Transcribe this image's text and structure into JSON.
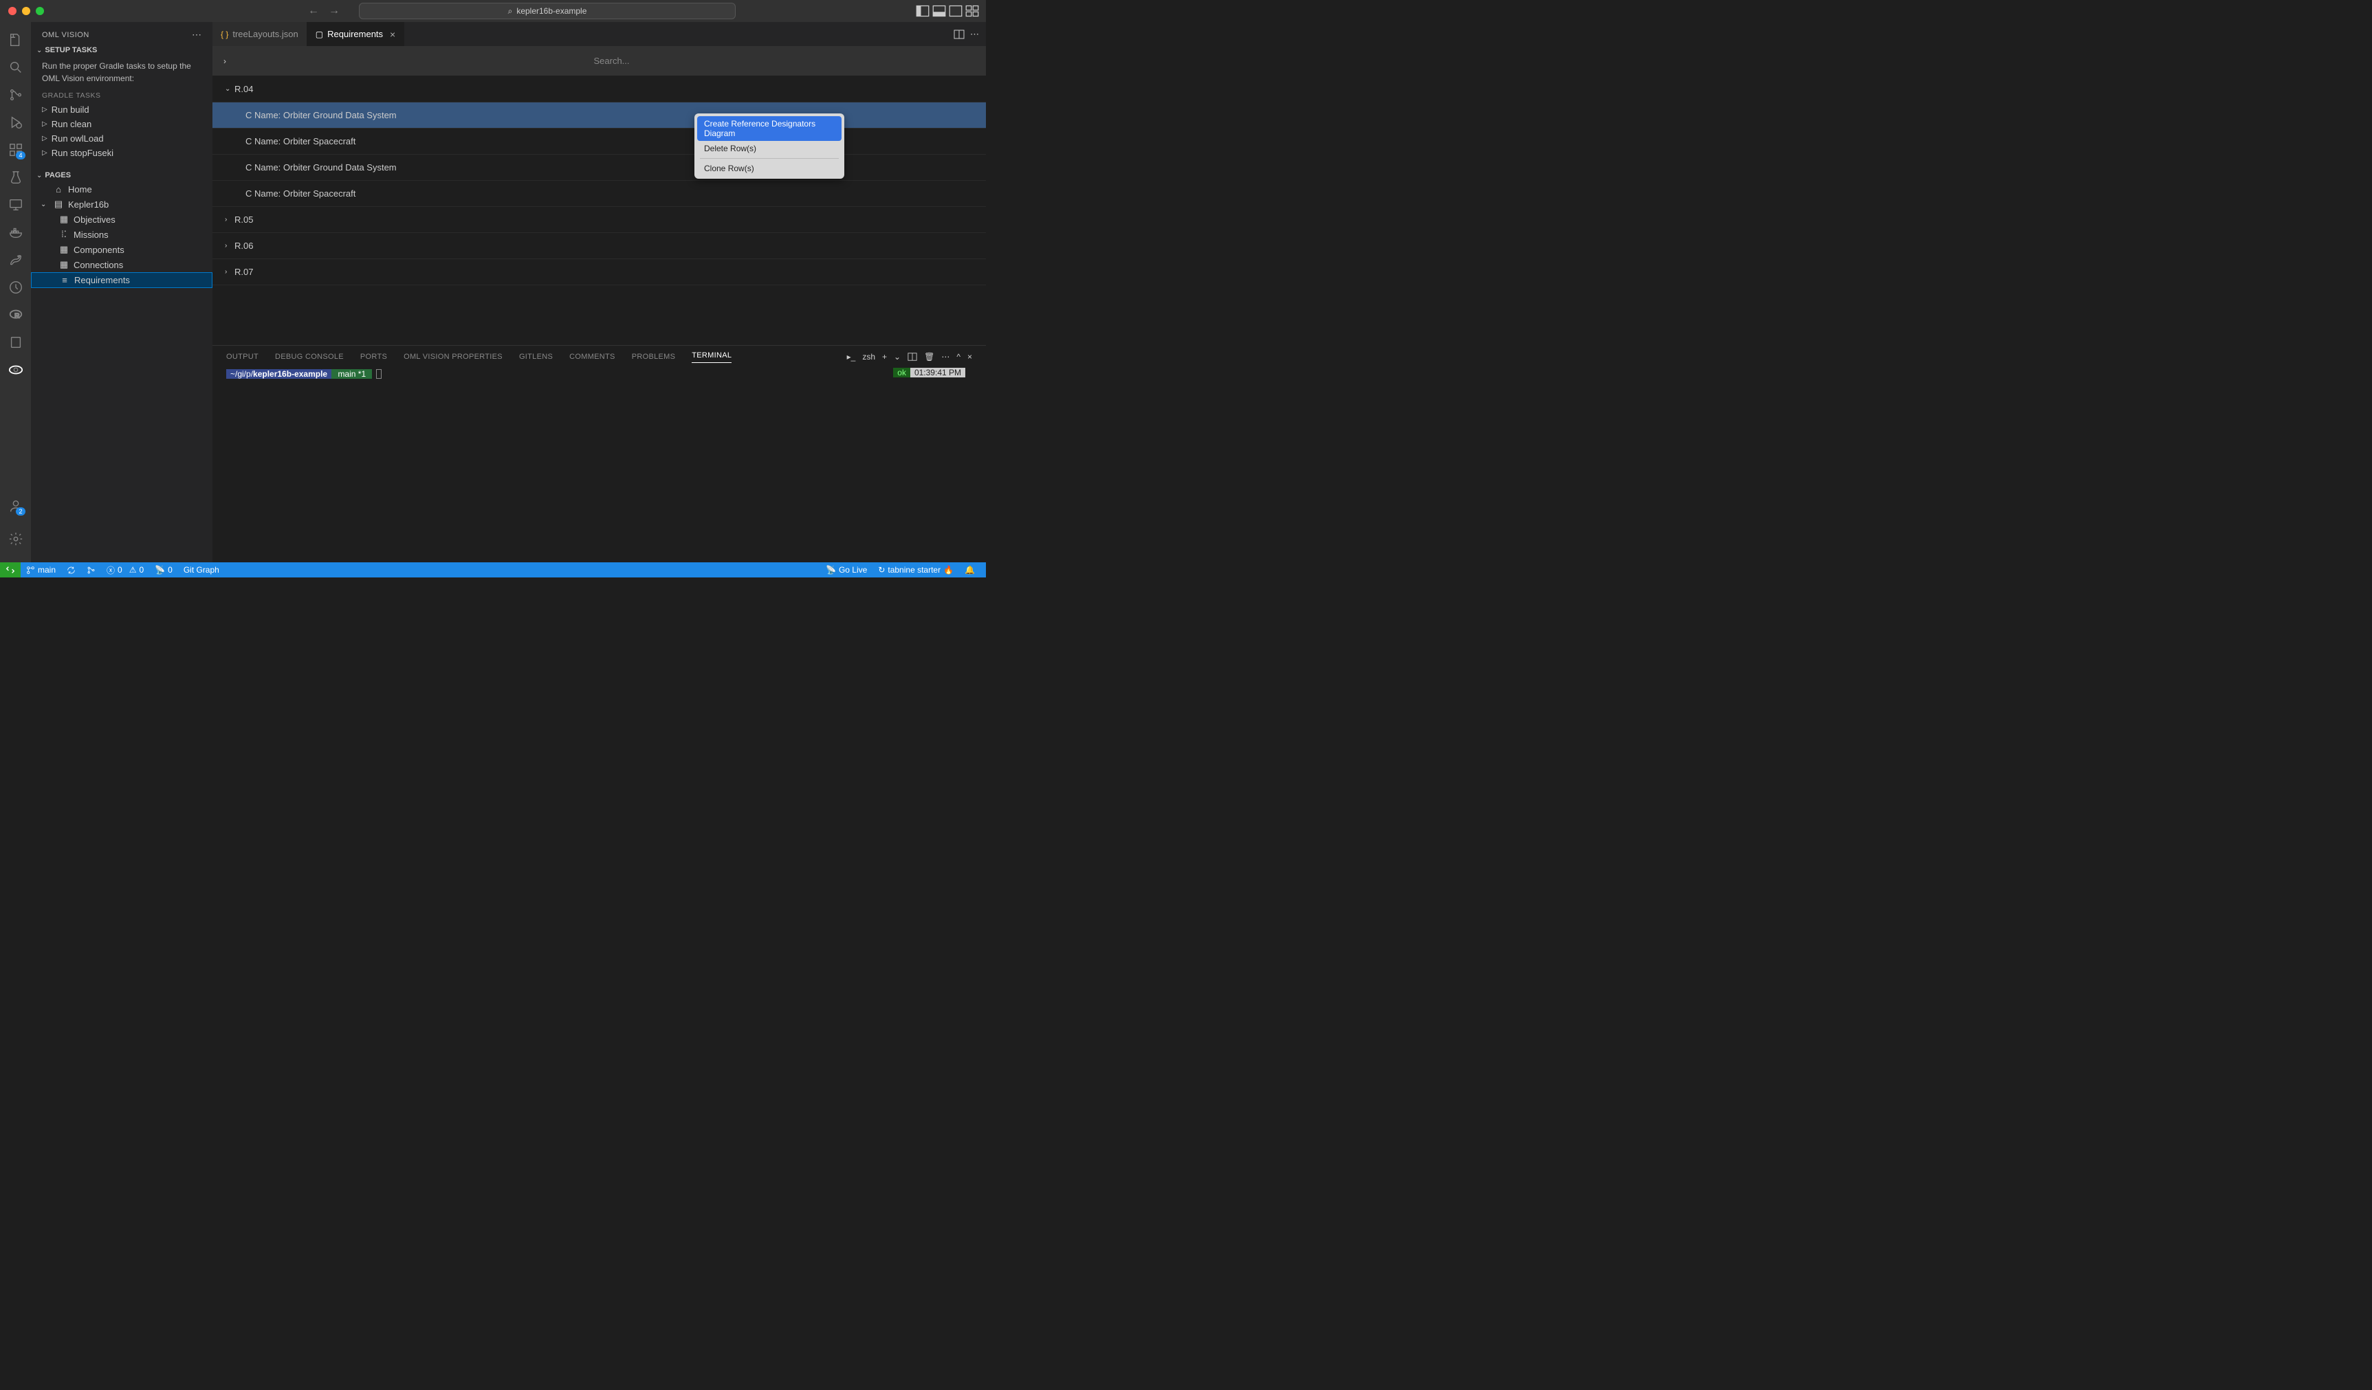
{
  "titlebar": {
    "search_text": "kepler16b-example"
  },
  "sidebar": {
    "title": "OML VISION",
    "sections": {
      "setup": {
        "label": "SETUP TASKS",
        "description": "Run the proper Gradle tasks to setup the OML Vision environment:",
        "gradle_label": "GRADLE TASKS",
        "tasks": [
          "Run build",
          "Run clean",
          "Run owlLoad",
          "Run stopFuseki"
        ]
      },
      "pages": {
        "label": "PAGES",
        "items": {
          "home": "Home",
          "kepler": "Kepler16b",
          "children": [
            "Objectives",
            "Missions",
            "Components",
            "Connections",
            "Requirements"
          ]
        }
      }
    }
  },
  "tabs": [
    {
      "label": "treeLayouts.json",
      "icon": "{ }",
      "active": false
    },
    {
      "label": "Requirements",
      "icon": "▢",
      "active": true
    }
  ],
  "editor": {
    "search_placeholder": "Search...",
    "rows": [
      {
        "type": "group",
        "expanded": true,
        "label": "R.04"
      },
      {
        "type": "child",
        "label": "C Name: Orbiter Ground Data System",
        "selected": true
      },
      {
        "type": "child",
        "label": "C Name: Orbiter Spacecraft"
      },
      {
        "type": "child",
        "label": "C Name: Orbiter Ground Data System"
      },
      {
        "type": "child",
        "label": "C Name: Orbiter Spacecraft"
      },
      {
        "type": "group",
        "expanded": false,
        "label": "R.05"
      },
      {
        "type": "group",
        "expanded": false,
        "label": "R.06"
      },
      {
        "type": "group",
        "expanded": false,
        "label": "R.07"
      }
    ]
  },
  "context_menu": {
    "items": [
      "Create Reference Designators Diagram",
      "Delete Row(s)",
      "Clone Row(s)"
    ]
  },
  "panel": {
    "tabs": [
      "OUTPUT",
      "DEBUG CONSOLE",
      "PORTS",
      "OML VISION PROPERTIES",
      "GITLENS",
      "COMMENTS",
      "PROBLEMS",
      "TERMINAL"
    ],
    "active": "TERMINAL",
    "shell": "zsh",
    "terminal": {
      "path_prefix": "~/gi/p/",
      "path_bold": "kepler16b-example",
      "branch": "main *1",
      "status_ok": "ok",
      "status_time": "01:39:41 PM"
    }
  },
  "statusbar": {
    "branch": "main",
    "errors": "0",
    "warnings": "0",
    "ports": "0",
    "git_graph": "Git Graph",
    "go_live": "Go Live",
    "tabnine": "tabnine starter"
  },
  "badges": {
    "extensions": "4",
    "accounts": "2"
  }
}
